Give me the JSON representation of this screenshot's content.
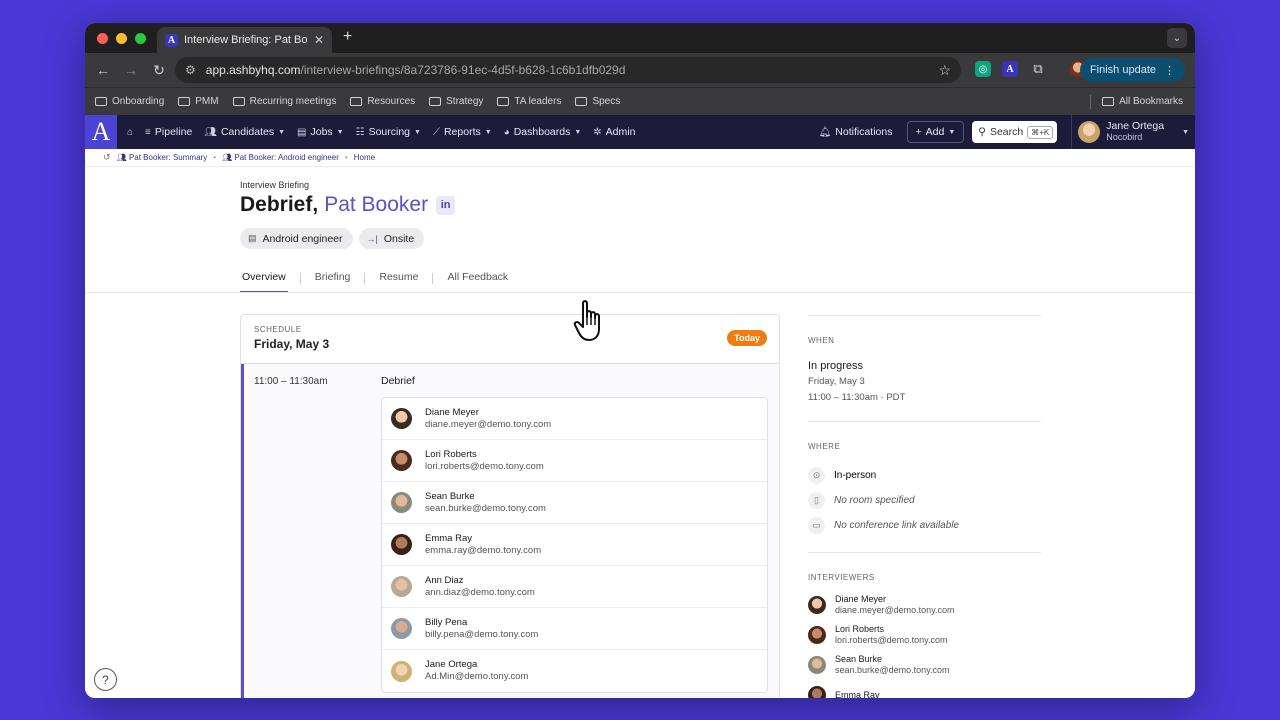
{
  "browser": {
    "tab_title": "Interview Briefing: Pat Booker",
    "tab_close": "✕",
    "new_tab": "+",
    "url_host": "app.ashbyhq.com",
    "url_path": "/interview-briefings/8a723786-91ec-4d5f-b628-1c6b1dfb029d",
    "finish_update": "Finish update",
    "bookmarks": [
      "Onboarding",
      "PMM",
      "Recurring meetings",
      "Resources",
      "Strategy",
      "TA leaders",
      "Specs"
    ],
    "all_bookmarks": "All Bookmarks"
  },
  "app": {
    "logo": "A",
    "nav": [
      "Pipeline",
      "Candidates",
      "Jobs",
      "Sourcing",
      "Reports",
      "Dashboards",
      "Admin"
    ],
    "notifications": "Notifications",
    "add": "Add",
    "search": "Search",
    "search_shortcut": "⌘+K",
    "user_name": "Jane Ortega",
    "user_org": "Nocobird"
  },
  "breadcrumbs": [
    "Pat Booker: Summary",
    "Pat Booker: Android engineer",
    "Home"
  ],
  "page": {
    "eyebrow": "Interview Briefing",
    "title_prefix": "Debrief,",
    "candidate": "Pat Booker",
    "linkedin": "in",
    "chips": [
      "Android engineer",
      "Onsite"
    ],
    "tabs": [
      "Overview",
      "Briefing",
      "Resume",
      "All Feedback"
    ]
  },
  "schedule": {
    "label": "SCHEDULE",
    "date": "Friday, May 3",
    "badge": "Today",
    "time": "11:00 – 11:30am",
    "session": "Debrief",
    "interviewers": [
      {
        "name": "Diane Meyer",
        "email": "diane.meyer@demo.tony.com"
      },
      {
        "name": "Lori Roberts",
        "email": "lori.roberts@demo.tony.com"
      },
      {
        "name": "Sean Burke",
        "email": "sean.burke@demo.tony.com"
      },
      {
        "name": "Emma Ray",
        "email": "emma.ray@demo.tony.com"
      },
      {
        "name": "Ann Diaz",
        "email": "ann.diaz@demo.tony.com"
      },
      {
        "name": "Billy Pena",
        "email": "billy.pena@demo.tony.com"
      },
      {
        "name": "Jane Ortega",
        "email": "Ad.Min@demo.tony.com"
      }
    ]
  },
  "side": {
    "when_label": "WHEN",
    "status": "In progress",
    "date": "Friday, May 3",
    "time": "11:00 – 11:30am · PDT",
    "where_label": "WHERE",
    "location": "In-person",
    "room": "No room specified",
    "conference": "No conference link available",
    "interviewers_label": "INTERVIEWERS",
    "interviewers": [
      {
        "name": "Diane Meyer",
        "email": "diane.meyer@demo.tony.com"
      },
      {
        "name": "Lori Roberts",
        "email": "lori.roberts@demo.tony.com"
      },
      {
        "name": "Sean Burke",
        "email": "sean.burke@demo.tony.com"
      },
      {
        "name": "Emma Ray",
        "email": ""
      }
    ]
  },
  "help": "?",
  "colors": {
    "accent": "#5a52c2",
    "brand": "#4b43d1",
    "today": "#f07d14",
    "nav_bg": "#1c1b3a"
  }
}
